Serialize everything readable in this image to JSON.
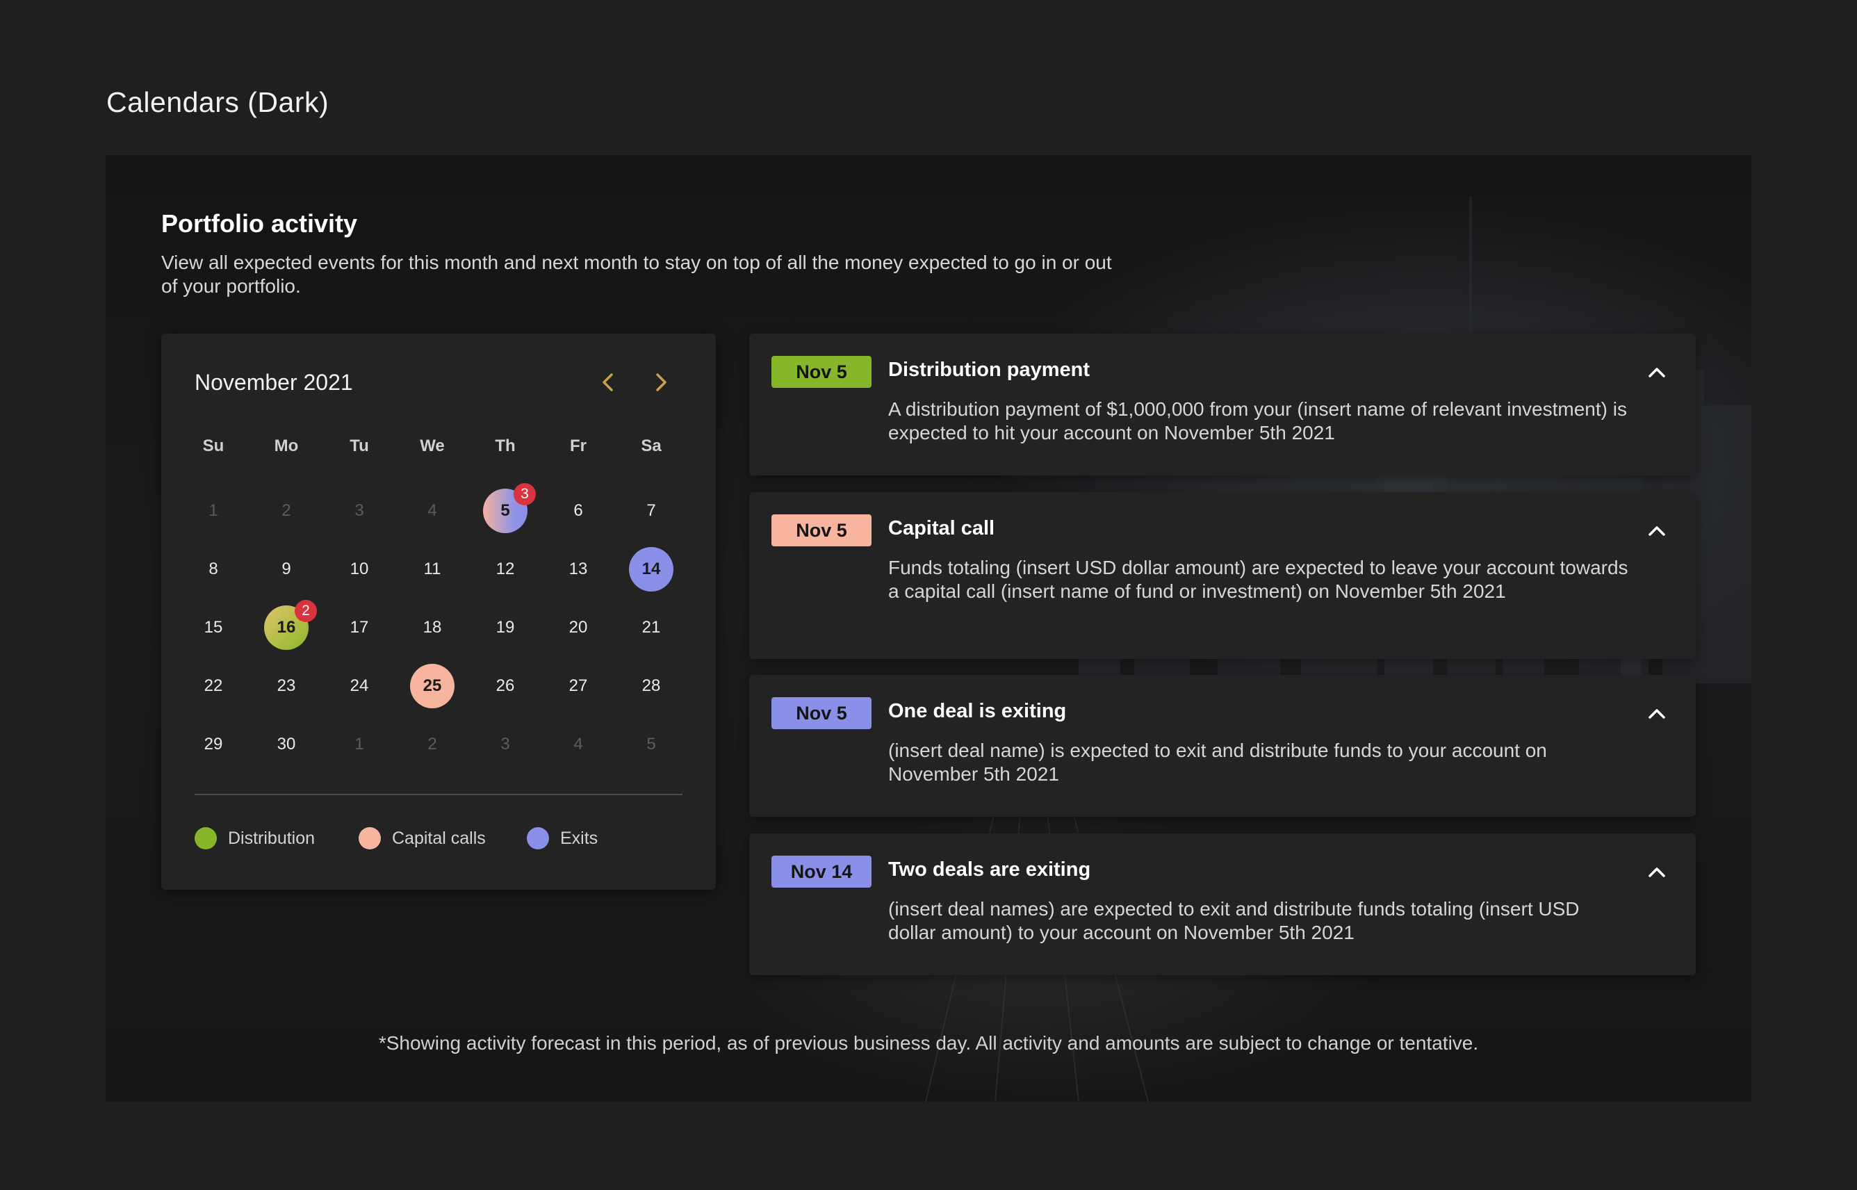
{
  "page": {
    "title": "Calendars (Dark)"
  },
  "section": {
    "title": "Portfolio activity",
    "description": "View all expected events for this month and next month to stay on top of all the money expected to go in or out of your portfolio."
  },
  "calendar": {
    "month_label": "November 2021",
    "prev_icon": "chevron-left-icon",
    "next_icon": "chevron-right-icon",
    "weekdays": [
      "Su",
      "Mo",
      "Tu",
      "We",
      "Th",
      "Fr",
      "Sa"
    ],
    "weeks": [
      [
        {
          "d": "1",
          "muted": true
        },
        {
          "d": "2",
          "muted": true
        },
        {
          "d": "3",
          "muted": true
        },
        {
          "d": "4",
          "muted": true
        },
        {
          "d": "5",
          "type": "mixed",
          "badge": "3"
        },
        {
          "d": "6"
        },
        {
          "d": "7"
        }
      ],
      [
        {
          "d": "8"
        },
        {
          "d": "9"
        },
        {
          "d": "10"
        },
        {
          "d": "11"
        },
        {
          "d": "12"
        },
        {
          "d": "13"
        },
        {
          "d": "14",
          "type": "exit"
        }
      ],
      [
        {
          "d": "15"
        },
        {
          "d": "16",
          "type": "distribution",
          "badge": "2"
        },
        {
          "d": "17"
        },
        {
          "d": "18"
        },
        {
          "d": "19"
        },
        {
          "d": "20"
        },
        {
          "d": "21"
        }
      ],
      [
        {
          "d": "22"
        },
        {
          "d": "23"
        },
        {
          "d": "24"
        },
        {
          "d": "25",
          "type": "capital"
        },
        {
          "d": "26"
        },
        {
          "d": "27"
        },
        {
          "d": "28"
        }
      ],
      [
        {
          "d": "29"
        },
        {
          "d": "30"
        },
        {
          "d": "1",
          "muted": true
        },
        {
          "d": "2",
          "muted": true
        },
        {
          "d": "3",
          "muted": true
        },
        {
          "d": "4",
          "muted": true
        },
        {
          "d": "5",
          "muted": true
        }
      ]
    ],
    "legend": [
      {
        "label": "Distribution",
        "color": "#86b62a"
      },
      {
        "label": "Capital calls",
        "color": "#f7b49e"
      },
      {
        "label": "Exits",
        "color": "#8a8fe8"
      }
    ]
  },
  "colors": {
    "accent_gold": "#c9a14a",
    "distribution": "#86b62a",
    "capital_call": "#f7b49e",
    "exit": "#8a8fe8",
    "badge": "#d8333f"
  },
  "events": [
    {
      "date": "Nov 5",
      "title": "Distribution payment",
      "body": "A distribution payment of $1,000,000 from your (insert name of relevant investment) is expected to hit your account on November 5th 2021",
      "color": "#86b62a"
    },
    {
      "date": "Nov 5",
      "title": "Capital call",
      "body": "Funds totaling (insert USD dollar amount) are expected to leave your account towards a capital call (insert name of fund or investment) on November 5th 2021",
      "color": "#f7b49e"
    },
    {
      "date": "Nov 5",
      "title": "One deal is exiting",
      "body": "(insert deal name) is expected to exit and distribute funds to your account on November 5th 2021",
      "color": "#8a8fe8"
    },
    {
      "date": "Nov 14",
      "title": "Two deals are exiting",
      "body": "(insert deal names) are expected to exit and distribute funds totaling (insert USD dollar amount) to your account on November 5th 2021",
      "color": "#8a8fe8"
    }
  ],
  "footnote": "*Showing activity forecast in this period, as of previous business day. All activity and amounts are subject to change or tentative."
}
